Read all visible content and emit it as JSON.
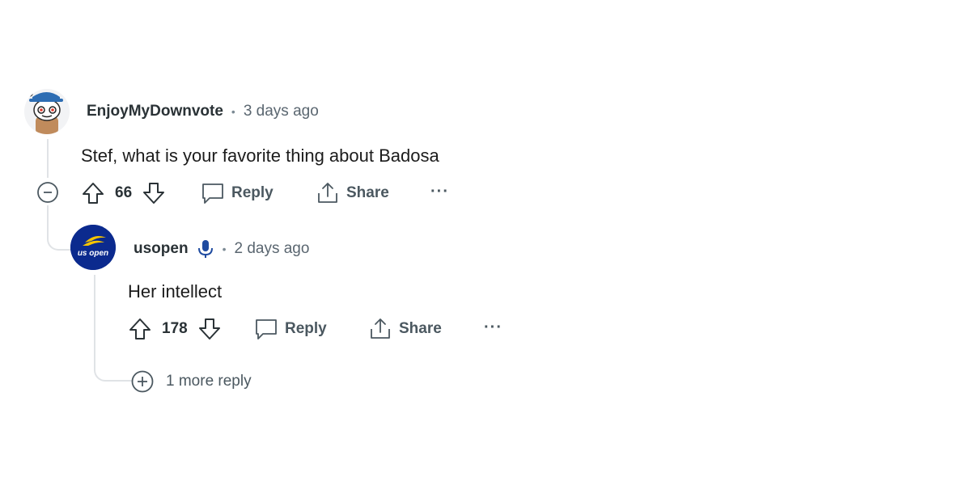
{
  "comments": [
    {
      "username": "EnjoyMyDownvote",
      "separator": "•",
      "time": "3 days ago",
      "body": "Stef, what is your favorite thing about Badosa",
      "votes": "66",
      "reply_label": "Reply",
      "share_label": "Share",
      "more_label": "···"
    },
    {
      "username": "usopen",
      "avatar_text": "us open",
      "separator": "•",
      "time": "2 days ago",
      "body": "Her intellect",
      "votes": "178",
      "reply_label": "Reply",
      "share_label": "Share",
      "more_label": "···"
    }
  ],
  "more_replies": "1 more reply",
  "icons": {
    "collapse": "minus-circle-icon",
    "upvote": "arrow-up-icon",
    "downvote": "arrow-down-icon",
    "reply": "comment-bubble-icon",
    "share": "share-icon",
    "more": "ellipsis-icon",
    "expand": "plus-circle-icon",
    "mod": "microphone-icon"
  },
  "colors": {
    "usopen_brand": "#0b2a8e",
    "usopen_accent": "#f5c400",
    "mod_icon": "#1f4ba0",
    "thread_line": "#e0e3e6"
  }
}
